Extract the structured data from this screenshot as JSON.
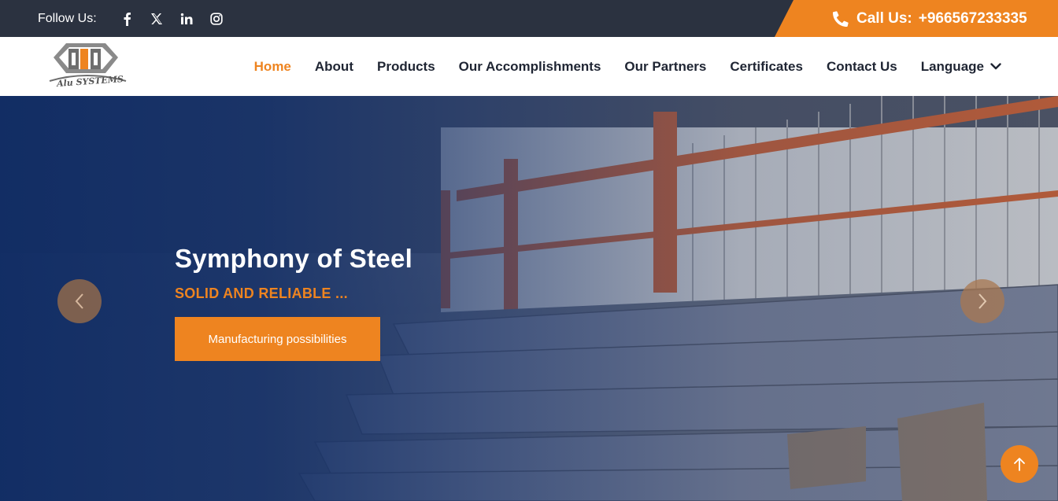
{
  "topbar": {
    "follow_label": "Follow Us:",
    "social": [
      "facebook-icon",
      "x-icon",
      "linkedin-icon",
      "instagram-icon"
    ],
    "call_label": "Call Us:",
    "phone": "+966567233335"
  },
  "logo": {
    "text": "Alu SYSTEMS"
  },
  "nav": {
    "items": [
      {
        "label": "Home",
        "active": true
      },
      {
        "label": "About"
      },
      {
        "label": "Products"
      },
      {
        "label": "Our Accomplishments"
      },
      {
        "label": "Our Partners"
      },
      {
        "label": "Certificates"
      },
      {
        "label": "Contact Us"
      },
      {
        "label": "Language"
      }
    ]
  },
  "hero": {
    "title": "Symphony of Steel",
    "subtitle": "SOLID AND RELIABLE ...",
    "button_label": "Manufacturing possibilities"
  },
  "colors": {
    "accent": "#ee8420",
    "topbar": "#2b3240",
    "nav_text": "#1f2533",
    "hero_overlay": "#102c64"
  }
}
